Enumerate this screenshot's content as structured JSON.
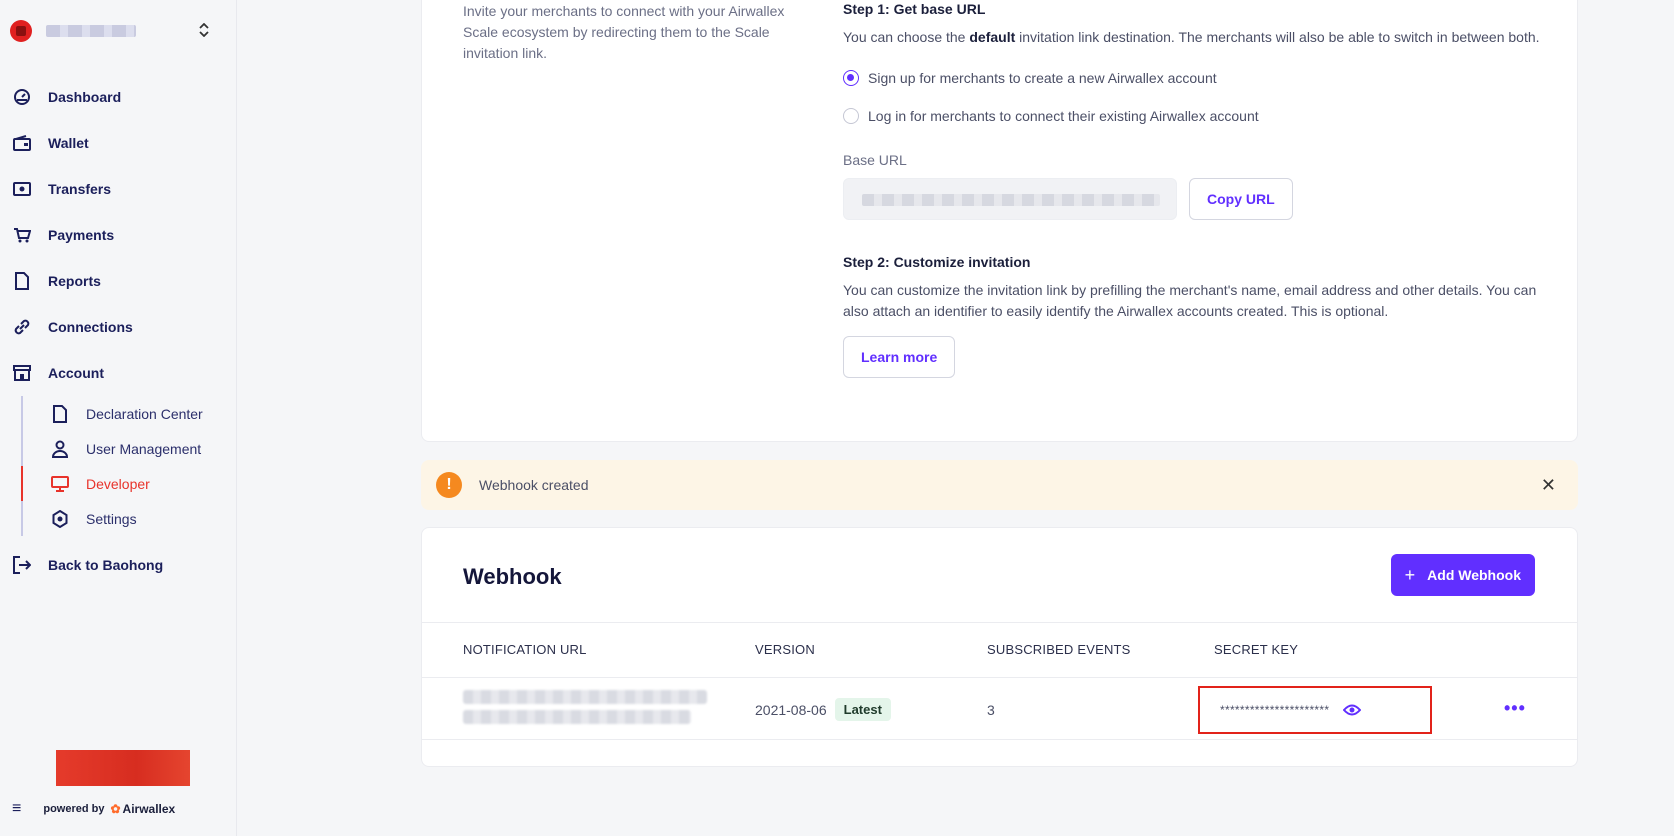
{
  "sidebar": {
    "org": {
      "toggle_icon": "chevron-updown-icon"
    },
    "nav": [
      {
        "label": "Dashboard",
        "icon": "dashboard-icon"
      },
      {
        "label": "Wallet",
        "icon": "wallet-icon"
      },
      {
        "label": "Transfers",
        "icon": "transfers-icon"
      },
      {
        "label": "Payments",
        "icon": "cart-icon"
      },
      {
        "label": "Reports",
        "icon": "document-icon"
      },
      {
        "label": "Connections",
        "icon": "link-icon"
      },
      {
        "label": "Account",
        "icon": "store-icon"
      }
    ],
    "account_sub": [
      {
        "label": "Declaration Center",
        "icon": "document-icon"
      },
      {
        "label": "User Management",
        "icon": "user-icon"
      },
      {
        "label": "Developer",
        "icon": "monitor-icon",
        "active": true
      },
      {
        "label": "Settings",
        "icon": "settings-icon"
      }
    ],
    "back": {
      "label": "Back to Baohong",
      "icon": "exit-icon"
    },
    "powered_by": "powered by",
    "brand": "Airwallex"
  },
  "scale": {
    "intro": "Invite your merchants to connect with your Airwallex Scale ecosystem by redirecting them to the Scale invitation link.",
    "step1_title": "Step 1: Get base URL",
    "step1_desc_pre": "You can choose the",
    "step1_desc_bold": "default",
    "step1_desc_post": "invitation link destination. The merchants will also be able to switch in between both.",
    "radio_signup": "Sign up for merchants to create a new Airwallex account",
    "radio_login": "Log in for merchants to connect their existing Airwallex account",
    "base_url_label": "Base URL",
    "copy_url": "Copy URL",
    "step2_title": "Step 2: Customize invitation",
    "step2_desc": "You can customize the invitation link by prefilling the merchant's name, email address and other details. You can also attach an identifier to easily identify the Airwallex accounts created. This is optional.",
    "learn_more": "Learn more"
  },
  "toast": {
    "icon": "!",
    "text": "Webhook created",
    "close": "✕"
  },
  "webhook": {
    "title": "Webhook",
    "add_button": "Add Webhook",
    "columns": [
      "NOTIFICATION URL",
      "VERSION",
      "SUBSCRIBED EVENTS",
      "SECRET KEY"
    ],
    "row": {
      "version": "2021-08-06",
      "badge": "Latest",
      "events": "3",
      "secret": "**********************",
      "more": "•••"
    }
  },
  "colors": {
    "accent": "#612fff",
    "active": "#e8332b",
    "highlight": "#e2231a"
  }
}
